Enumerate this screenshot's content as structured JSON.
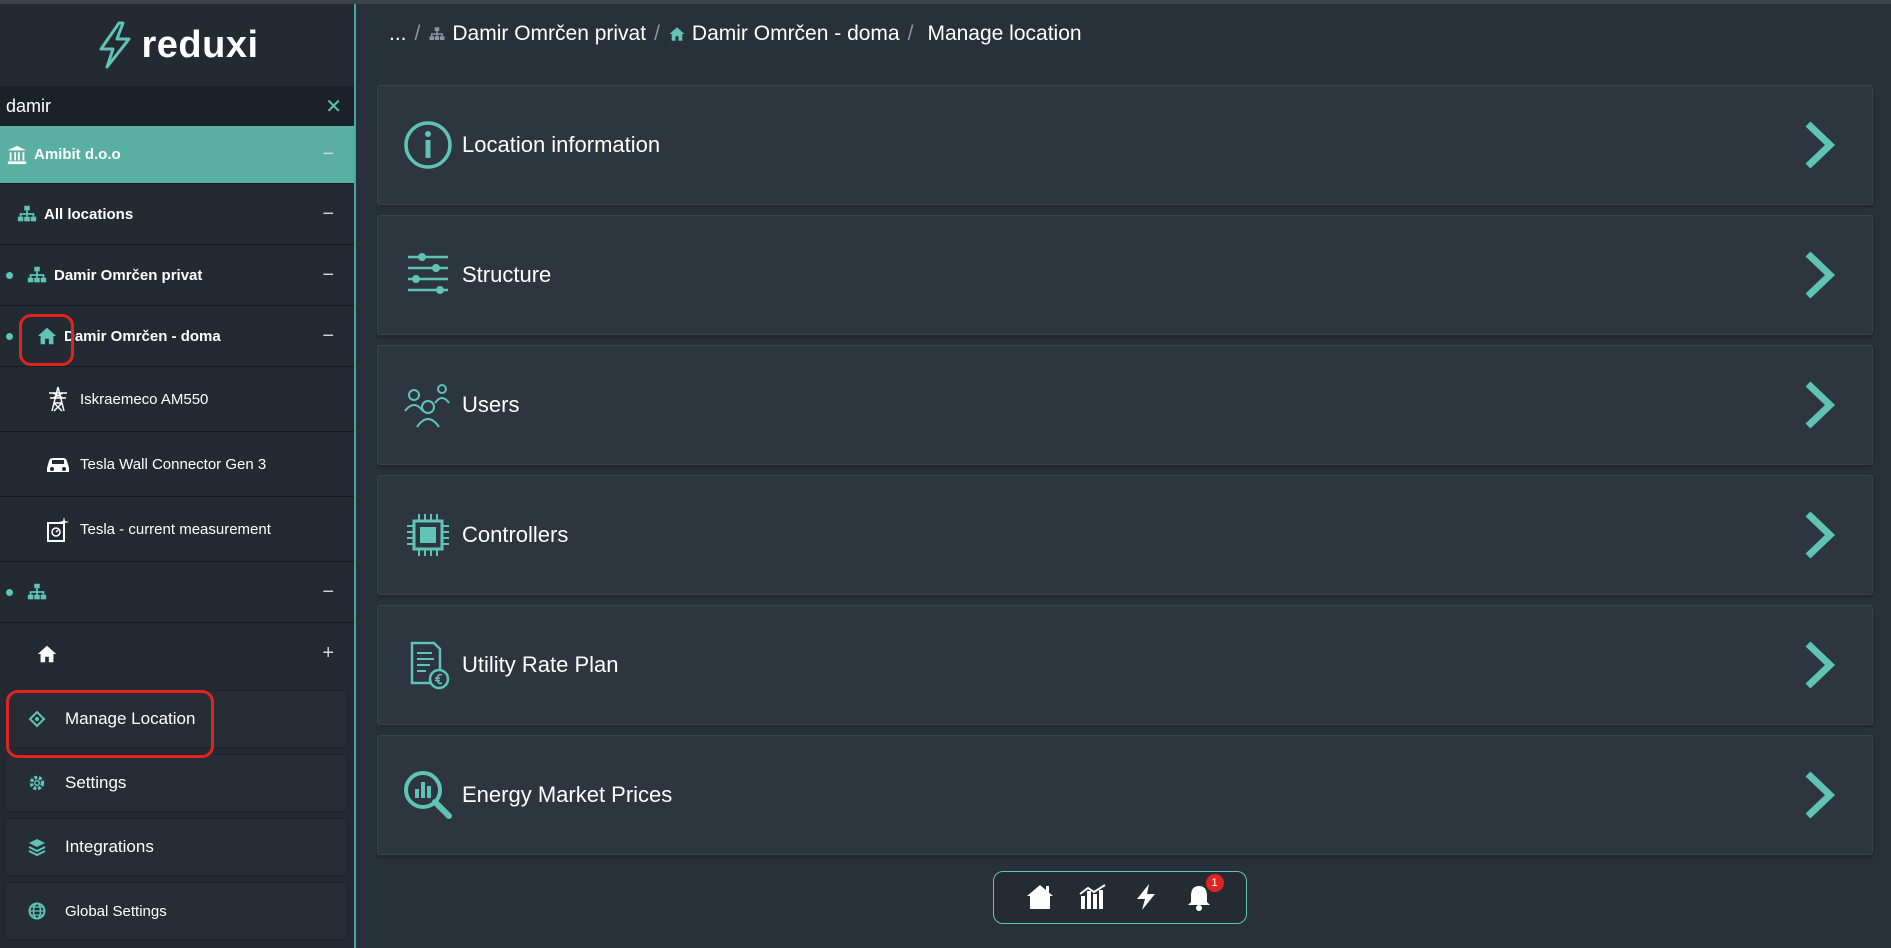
{
  "app": {
    "name": "reduxi"
  },
  "colors": {
    "accent": "#5fc4b6",
    "active_row": "#5aafa3",
    "background": "#283039",
    "sidebar": "#232a32",
    "highlight": "#e02424"
  },
  "search": {
    "value": "damir"
  },
  "tree": {
    "company": {
      "label": "Amibit d.o.o",
      "toggle": "−"
    },
    "all_locations": {
      "label": "All locations",
      "toggle": "−"
    },
    "group": {
      "label": "Damir Omrčen privat",
      "toggle": "−"
    },
    "location": {
      "label": "Damir Omrčen - doma",
      "toggle": "−"
    },
    "devices": [
      {
        "label": "Iskraemeco AM550",
        "icon": "power-tower-icon"
      },
      {
        "label": "Tesla Wall Connector Gen 3",
        "icon": "car-icon"
      },
      {
        "label": "Tesla - current measurement",
        "icon": "meter-icon"
      }
    ],
    "group2": {
      "toggle": "−"
    },
    "location2": {
      "toggle": "+"
    }
  },
  "menu": {
    "manage_location": "Manage Location",
    "settings": "Settings",
    "integrations": "Integrations",
    "global_settings": "Global Settings"
  },
  "breadcrumb": {
    "ellipsis": "...",
    "group": "Damir Omrčen privat",
    "location": "Damir Omrčen - doma",
    "current": "Manage location"
  },
  "cards": [
    {
      "title": "Location information",
      "icon": "info-icon"
    },
    {
      "title": "Structure",
      "icon": "sliders-icon"
    },
    {
      "title": "Users",
      "icon": "users-icon"
    },
    {
      "title": "Controllers",
      "icon": "chip-icon"
    },
    {
      "title": "Utility Rate Plan",
      "icon": "invoice-euro-icon"
    },
    {
      "title": "Energy Market Prices",
      "icon": "chart-search-icon"
    }
  ],
  "bottom_bar": {
    "notification_count": "1"
  }
}
